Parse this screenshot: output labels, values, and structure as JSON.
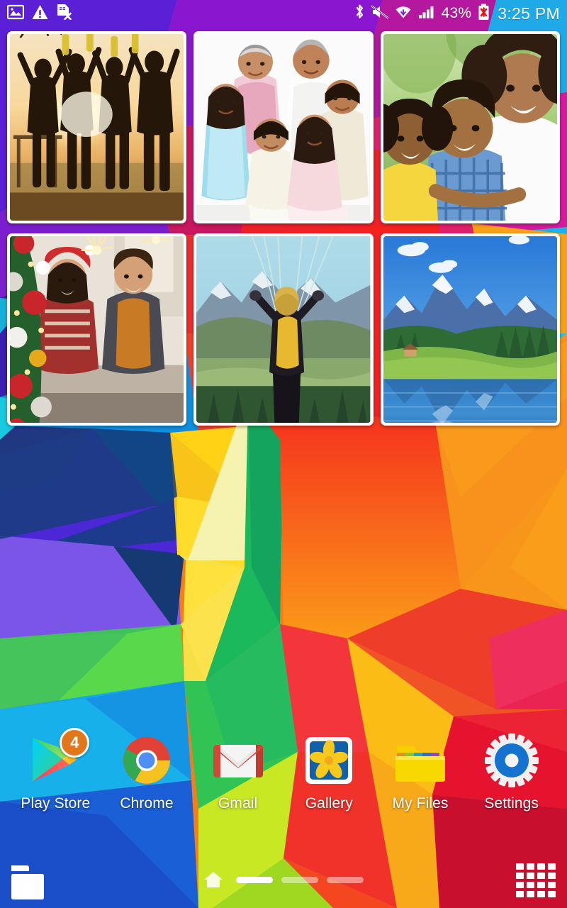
{
  "status_bar": {
    "left_icons": [
      {
        "name": "screenshot-icon",
        "label": "Screenshot captured"
      },
      {
        "name": "warning-icon",
        "label": "Warning"
      },
      {
        "name": "sim-card-error-icon",
        "label": "SIM card error"
      }
    ],
    "right_icons": [
      {
        "name": "bluetooth-icon",
        "label": "Bluetooth"
      },
      {
        "name": "mute-icon",
        "label": "Sound muted"
      },
      {
        "name": "wifi-icon",
        "label": "Wi-Fi"
      },
      {
        "name": "signal-icon",
        "label": "Cellular signal"
      }
    ],
    "battery_percent": "43%",
    "battery_state": "error",
    "clock": "3:25 PM"
  },
  "photo_widget": {
    "name": "Gallery photo widget",
    "rows": 2,
    "columns": 3,
    "photos": [
      {
        "id": "photo-1",
        "caption": "Friends toasting at sunset"
      },
      {
        "id": "photo-2",
        "caption": "Indian family portrait"
      },
      {
        "id": "photo-3",
        "caption": "Mother hugging two children outdoors"
      },
      {
        "id": "photo-4",
        "caption": "Christmas party with sparklers"
      },
      {
        "id": "photo-5",
        "caption": "Paragliding over mountains"
      },
      {
        "id": "photo-6",
        "caption": "Alpine lake with snowy mountains"
      }
    ]
  },
  "dock": {
    "apps": [
      {
        "label": "Play Store",
        "icon": "play-store-icon",
        "badge": "4"
      },
      {
        "label": "Chrome",
        "icon": "chrome-icon",
        "badge": null
      },
      {
        "label": "Gmail",
        "icon": "gmail-icon",
        "badge": null
      },
      {
        "label": "Gallery",
        "icon": "gallery-icon",
        "badge": null
      },
      {
        "label": "My Files",
        "icon": "my-files-icon",
        "badge": null
      },
      {
        "label": "Settings",
        "icon": "settings-icon",
        "badge": null
      }
    ]
  },
  "bottom_bar": {
    "folder_button": "folder-icon",
    "home_button": "home-icon",
    "apps_button": "app-drawer-icon",
    "pages": [
      {
        "index": 1,
        "active": true
      },
      {
        "index": 2,
        "active": false
      },
      {
        "index": 3,
        "active": false
      }
    ]
  },
  "colors": {
    "badge": "#e2761b",
    "status_text": "#ffffff",
    "label_text": "#ffffff",
    "page_dot_active": "#ffffff",
    "play_store_green": "#3bcc6e",
    "play_store_blue": "#2ab9f0",
    "play_store_yellow": "#ffce2e",
    "play_store_red": "#f4435c",
    "chrome_red": "#e04235",
    "chrome_yellow": "#f5c220",
    "chrome_green": "#31a851",
    "chrome_blue": "#4e8ef5",
    "gmail_red": "#d44638",
    "gallery_yellow": "#f8c91d",
    "gallery_blue": "#1466b5",
    "files_yellow": "#f5d700",
    "settings_blue": "#1572cf"
  }
}
